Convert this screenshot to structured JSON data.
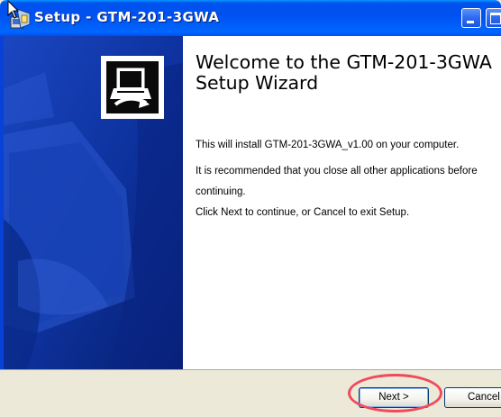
{
  "window": {
    "title": "Setup - GTM-201-3GWA"
  },
  "wizard": {
    "heading_line1": "Welcome to the GTM-201-3GWA",
    "heading_line2": "Setup Wizard",
    "paragraph1": "This will install GTM-201-3GWA_v1.00 on your computer.",
    "paragraph2": "It is recommended that you close all other applications before",
    "paragraph2b": "continuing.",
    "paragraph3": "Click Next to continue, or Cancel to exit Setup."
  },
  "buttons": {
    "next_label": "Next >",
    "cancel_label": "Cancel"
  },
  "icons": {
    "title": "setup-installer-icon",
    "logo": "computer-install-icon",
    "minimize": "minimize-icon",
    "maximize": "maximize-icon",
    "cursor": "mouse-pointer-icon"
  },
  "colors": {
    "titlebar": "#0053ee",
    "banner": "#0b2d8e",
    "highlight": "#f04a5c",
    "dialog_background": "#ece9d8"
  }
}
